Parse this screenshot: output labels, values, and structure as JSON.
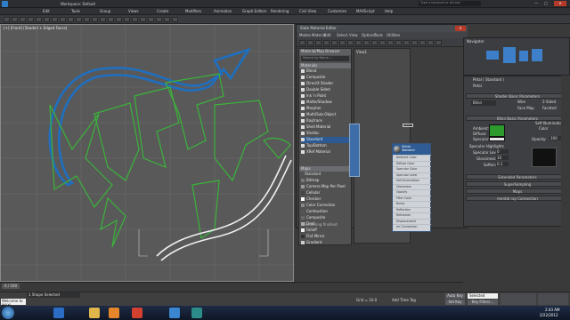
{
  "window": {
    "title": "Workspace: Default",
    "search_placeholder": "Type a keyword or phrase"
  },
  "menubar": {
    "items": [
      "Edit",
      "Tools",
      "Group",
      "Views",
      "Create",
      "Modifiers",
      "Animation",
      "Graph Editors",
      "Rendering",
      "Civil View",
      "Customize",
      "MAXScript",
      "Help"
    ]
  },
  "viewport": {
    "label": "[+] [Front] [Shaded + Edged Faces]"
  },
  "material_editor": {
    "title": "Slate Material Editor",
    "menus": [
      "Modes",
      "Material",
      "Edit",
      "Select",
      "View",
      "Options",
      "Tools",
      "Utilities"
    ],
    "view_field": "View1",
    "panel_label": "Material/Map Browser",
    "search_placeholder": "Search by Name ...",
    "materials_header": "Materials",
    "materials": [
      "Blend",
      "Composite",
      "DirectX Shader",
      "Double Sided",
      "Ink 'n Paint",
      "Matte/Shadow",
      "Morpher",
      "Multi/Sub-Object",
      "Raytrace",
      "Shell Material",
      "Shellac",
      "Standard",
      "Top/Bottom",
      "XRef Material"
    ],
    "maps_header": "Maps",
    "maps_sub": "Standard",
    "maps": [
      "Bitmap",
      "Camera Map Per Pixel",
      "Cellular",
      "Checker",
      "Color Correction",
      "Combustion",
      "Composite",
      "Dent",
      "Falloff",
      "Flat Mirror",
      "Gradient"
    ],
    "node": {
      "name": "Shiner",
      "type": "Standard",
      "slots": [
        "Ambient Color",
        "Diffuse Color",
        "Specular Color",
        "Specular Level",
        "Self-Illumination",
        "Glossiness",
        "Opacity",
        "Filter Color",
        "Bump",
        "Reflection",
        "Refraction",
        "Displacement",
        "mr Connection"
      ]
    },
    "status": "Rendering finished"
  },
  "properties": {
    "navigator_label": "Navigator",
    "name_field": "Box1",
    "material_name": "Petal  ( Standard )",
    "subheader": "Petal",
    "shader_rollout": "Shader Basic Parameters",
    "shader_type": "Blinn",
    "shader_options": [
      "Wire",
      "2-Sided",
      "Face Map",
      "Faceted"
    ],
    "blinn_rollout": "Blinn Basic Parameters",
    "self_illum": "Self-Illumination",
    "color_label": "Color",
    "ambient": "Ambient:",
    "diffuse": "Diffuse:",
    "specular": "Specular:",
    "opacity": "Opacity:",
    "opacity_value": "100",
    "spec_highlights": "Specular Highlights",
    "spec_level": "Specular Level:",
    "glossiness": "Glossiness:",
    "soften": "Soften:",
    "soften_value": "0.1",
    "spec_level_value": "0",
    "gloss_value": "10",
    "rollouts": [
      "Extended Parameters",
      "SuperSampling",
      "Maps",
      "mental ray Connection"
    ]
  },
  "timeline": {
    "position": "0 / 100"
  },
  "status": {
    "selection": "1 Shape Selected",
    "prompt": "Welcome to MAX!",
    "grid": "Grid = 10.0",
    "autokey": "Auto Key",
    "selected": "Selected",
    "setkey": "Set Key",
    "filters": "Key Filters...",
    "add_time_tag": "Add Time Tag"
  },
  "taskbar": {
    "time": "2:43 AM",
    "date": "2/22/2012"
  },
  "colors": {
    "viewport_bg": "#595959",
    "blue_curve": "#1f6fc0",
    "green_curves": "#3ab43a",
    "selection": "#1a4d8f"
  }
}
